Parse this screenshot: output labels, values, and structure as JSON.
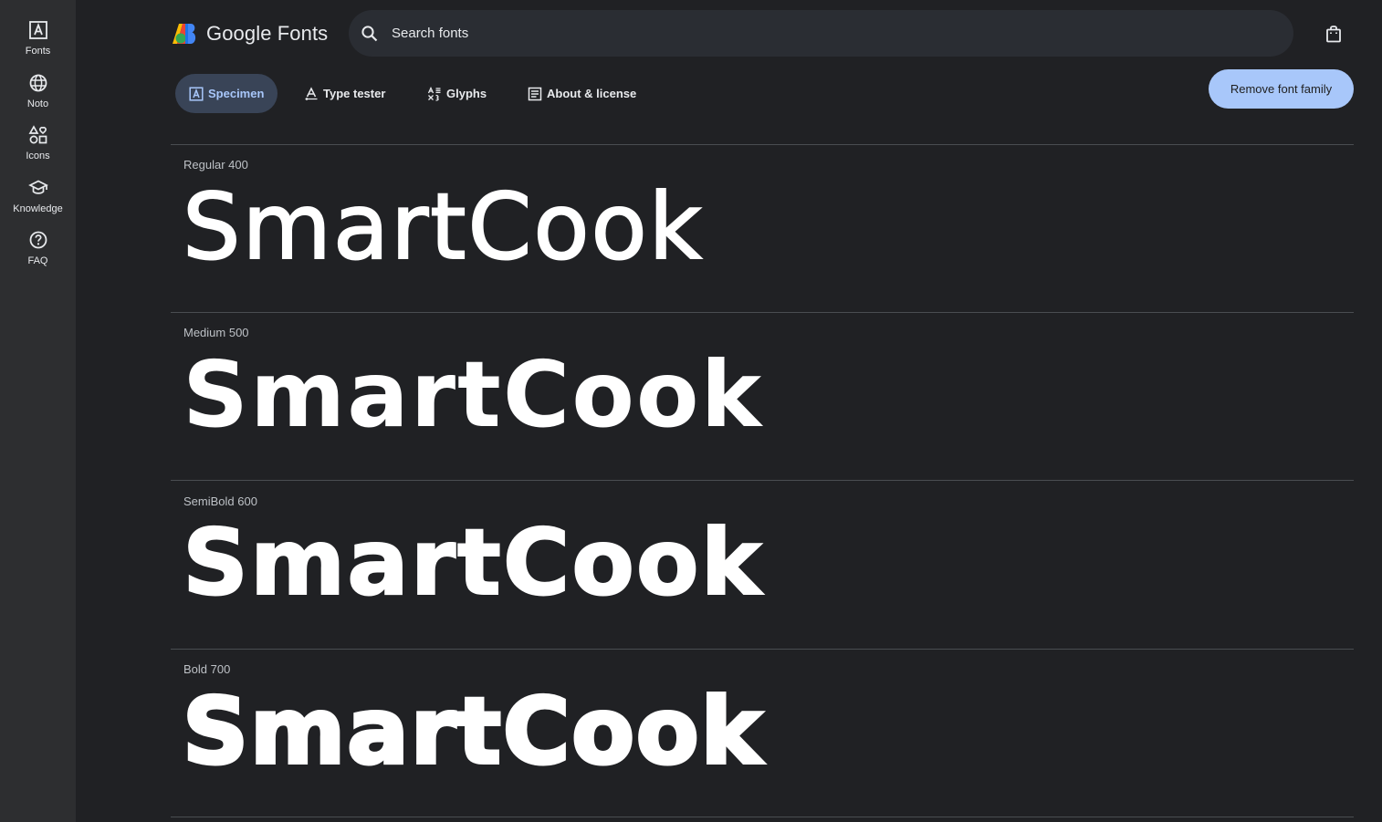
{
  "rail": {
    "items": [
      {
        "label": "Fonts",
        "icon": "font-icon"
      },
      {
        "label": "Noto",
        "icon": "globe-icon"
      },
      {
        "label": "Icons",
        "icon": "shapes-icon"
      },
      {
        "label": "Knowledge",
        "icon": "graduation-cap-icon"
      },
      {
        "label": "FAQ",
        "icon": "help-circle-icon"
      }
    ]
  },
  "header": {
    "logo_text": "Google Fonts",
    "search_placeholder": "Search fonts"
  },
  "tabs": [
    {
      "label": "Specimen",
      "icon": "font-icon",
      "active": true
    },
    {
      "label": "Type tester",
      "icon": "type-tester-icon",
      "active": false
    },
    {
      "label": "Glyphs",
      "icon": "glyphs-icon",
      "active": false
    },
    {
      "label": "About & license",
      "icon": "article-icon",
      "active": false
    }
  ],
  "actions": {
    "remove_label": "Remove font family"
  },
  "specimens": [
    {
      "style": "Regular 400",
      "sample": "SmartCook",
      "weight": 400
    },
    {
      "style": "Medium 500",
      "sample": "SmartCook",
      "weight": 500
    },
    {
      "style": "SemiBold 600",
      "sample": "SmartCook",
      "weight": 600
    },
    {
      "style": "Bold 700",
      "sample": "SmartCook",
      "weight": 700
    }
  ],
  "colors": {
    "background": "#202124",
    "rail": "#2d2e30",
    "accent": "#a8c7fa",
    "active_tab_bg": "#394457"
  }
}
